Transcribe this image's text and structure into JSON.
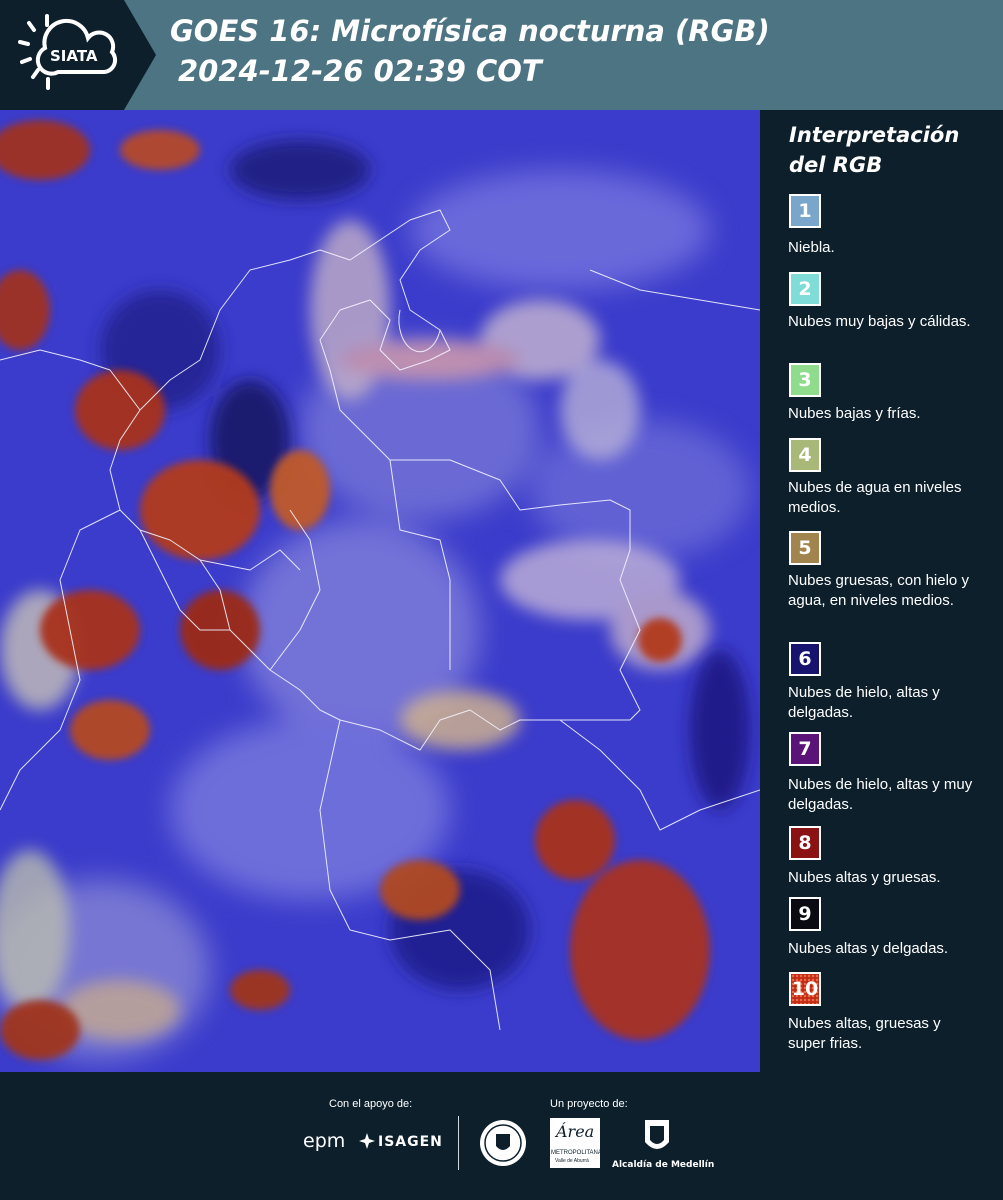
{
  "header": {
    "logo_text": "SIATA",
    "title_line1": "GOES 16: Microfísica nocturna (RGB)",
    "title_line2": "2024-12-26 02:39 COT"
  },
  "map": {
    "image_description_hidden": "",
    "base_color": "#3a3ac8"
  },
  "legend": {
    "title": "Interpretación del RGB",
    "items": [
      {
        "number": "1",
        "label": "Niebla.",
        "color": "#7aa6cc"
      },
      {
        "number": "2",
        "label": "Nubes muy bajas y cálidas.",
        "color": "#7fdcd6"
      },
      {
        "number": "3",
        "label": "Nubes bajas y frías.",
        "color": "#8fdc8c"
      },
      {
        "number": "4",
        "label": "Nubes de agua en niveles medios.",
        "color": "#a8b878"
      },
      {
        "number": "5",
        "label": "Nubes gruesas, con hielo y agua, en niveles medios.",
        "color": "#a2844e"
      },
      {
        "number": "6",
        "label": "Nubes de hielo, altas y delgadas.",
        "color": "#16146e"
      },
      {
        "number": "7",
        "label": "Nubes de hielo, altas y muy delgadas.",
        "color": "#5a1478"
      },
      {
        "number": "8",
        "label": "Nubes altas y gruesas.",
        "color": "#8a1212"
      },
      {
        "number": "9",
        "label": "Nubes altas y delgadas.",
        "color": "#0a0a12"
      },
      {
        "number": "10",
        "label": "Nubes altas, gruesas y super frias.",
        "color": "#c22a14"
      }
    ]
  },
  "footer": {
    "support_caption": "Con el apoyo de:",
    "project_caption": "Un proyecto de:",
    "epm_text": "epm",
    "isagen_text": "ISAGEN",
    "metro_text": "METROPOLITANA",
    "metro_sub": "Valle de Aburrá",
    "metro_script": "Área",
    "alcaldia_text": "Alcaldía de Medellín"
  }
}
